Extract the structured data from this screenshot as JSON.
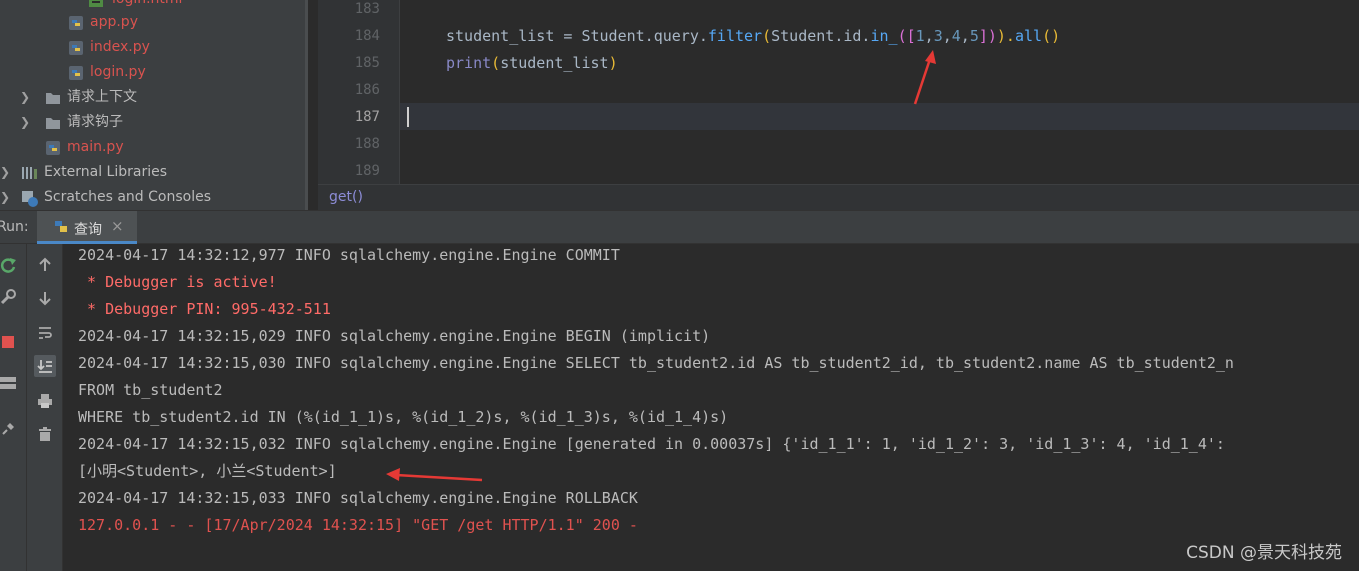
{
  "project_tree": {
    "items": [
      {
        "label": "login.html",
        "kind": "html"
      },
      {
        "label": "app.py",
        "kind": "py-red"
      },
      {
        "label": "index.py",
        "kind": "py-red"
      },
      {
        "label": "login.py",
        "kind": "py-red"
      },
      {
        "label": "请求上下文",
        "kind": "folder"
      },
      {
        "label": "请求钩子",
        "kind": "folder"
      },
      {
        "label": "main.py",
        "kind": "py-red"
      },
      {
        "label": "External Libraries",
        "kind": "libs"
      },
      {
        "label": "Scratches and Consoles",
        "kind": "scratch"
      }
    ]
  },
  "editor": {
    "line_numbers": [
      "183",
      "184",
      "185",
      "186",
      "187",
      "188",
      "189"
    ],
    "active_line": "187",
    "line184": {
      "t1": "student_list = Student.query.",
      "t2": "filter",
      "t3": "(",
      "t4": "Student.id.",
      "t5": "in_",
      "t6": "([",
      "n1": "1",
      "c1": ",",
      "n2": "3",
      "c2": ",",
      "n3": "4",
      "c3": ",",
      "n4": "5",
      "t7": "])",
      "t8": ").",
      "t9": "all",
      "t10": "()"
    },
    "line185": {
      "t1": "print",
      "t2": "(",
      "t3": "student_list",
      "t4": ")"
    }
  },
  "breadcrumb": "get()",
  "run_panel": {
    "label": "Run:",
    "tab_label": "查询",
    "close_glyph": "×"
  },
  "console": {
    "lines": [
      {
        "text": "2024-04-17 14:32:12,977 INFO sqlalchemy.engine.Engine COMMIT",
        "style": "normal"
      },
      {
        "text": " * Debugger is active!",
        "style": "err"
      },
      {
        "text": " * Debugger PIN: 995-432-511",
        "style": "err"
      },
      {
        "text": "2024-04-17 14:32:15,029 INFO sqlalchemy.engine.Engine BEGIN (implicit)",
        "style": "normal"
      },
      {
        "text": "2024-04-17 14:32:15,030 INFO sqlalchemy.engine.Engine SELECT tb_student2.id AS tb_student2_id, tb_student2.name AS tb_student2_n",
        "style": "normal"
      },
      {
        "text": "FROM tb_student2",
        "style": "normal"
      },
      {
        "text": "WHERE tb_student2.id IN (%(id_1_1)s, %(id_1_2)s, %(id_1_3)s, %(id_1_4)s)",
        "style": "normal"
      },
      {
        "text": "2024-04-17 14:32:15,032 INFO sqlalchemy.engine.Engine [generated in 0.00037s] {'id_1_1': 1, 'id_1_2': 3, 'id_1_3': 4, 'id_1_4':",
        "style": "normal"
      },
      {
        "text": "[小明<Student>, 小兰<Student>]",
        "style": "normal"
      },
      {
        "text": "2024-04-17 14:32:15,033 INFO sqlalchemy.engine.Engine ROLLBACK",
        "style": "normal"
      },
      {
        "text": "127.0.0.1 - - [17/Apr/2024 14:32:15] \"GET /get HTTP/1.1\" 200 -",
        "style": "red2"
      }
    ]
  },
  "watermark": "CSDN @景天科技苑",
  "colors": {
    "annotation_arrow": "#e53935",
    "tab_underline": "#4a88c7",
    "error_text": "#ff6b68"
  }
}
